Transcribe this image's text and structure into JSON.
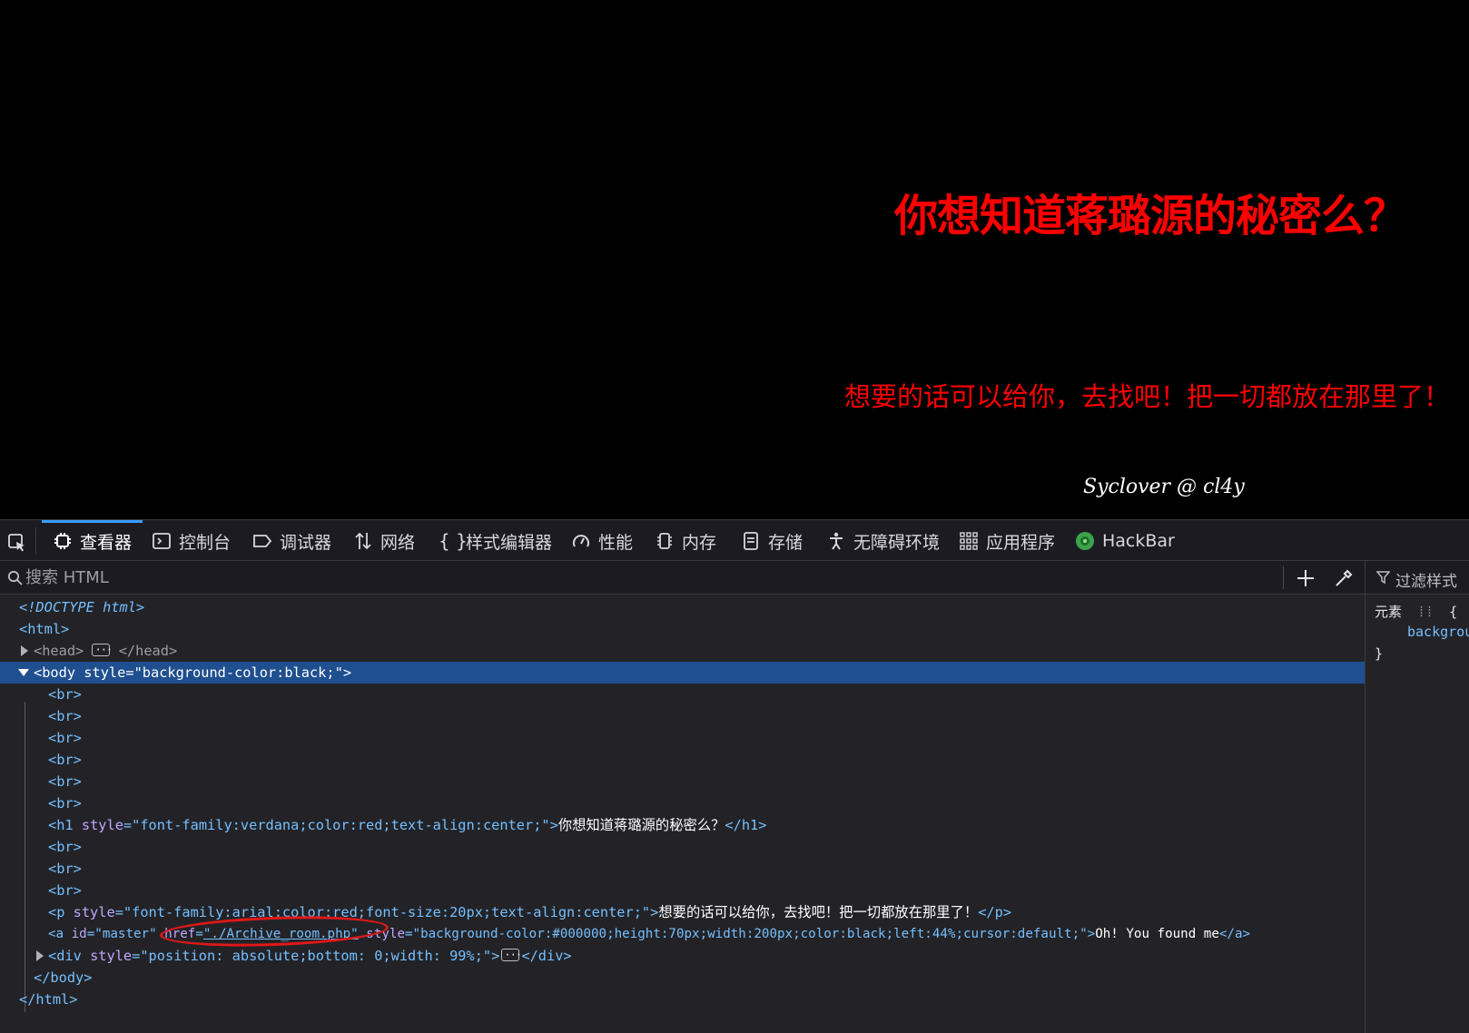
{
  "page": {
    "heading": "你想知道蒋璐源的秘密么？",
    "paragraph": "想要的话可以给你，去找吧！把一切都放在那里了！",
    "signature": "Syclover @ cl4y"
  },
  "devtools": {
    "tabs": [
      {
        "label": "查看器",
        "icon": "inspector-icon",
        "active": true
      },
      {
        "label": "控制台",
        "icon": "console-icon"
      },
      {
        "label": "调试器",
        "icon": "debugger-icon"
      },
      {
        "label": "网络",
        "icon": "network-icon"
      },
      {
        "label": "样式编辑器",
        "icon": "style-editor-icon"
      },
      {
        "label": "性能",
        "icon": "performance-icon"
      },
      {
        "label": "内存",
        "icon": "memory-icon"
      },
      {
        "label": "存储",
        "icon": "storage-icon"
      },
      {
        "label": "无障碍环境",
        "icon": "accessibility-icon"
      },
      {
        "label": "应用程序",
        "icon": "application-icon"
      },
      {
        "label": "HackBar",
        "icon": "hackbar-icon"
      }
    ],
    "search": {
      "placeholder": "搜索 HTML",
      "value": ""
    },
    "rules": {
      "filter_label": "过滤样式",
      "element_label": "元素",
      "open_brace": "{",
      "property": "backgrou",
      "close_brace": "}"
    },
    "markup": {
      "doctype": "<!DOCTYPE html>",
      "html_open": "<html>",
      "head_open": "<head>",
      "head_close": "</head>",
      "body_open": "<body",
      "body_style_attr": "style",
      "body_style_val": "\"background-color:black;\"",
      "br": "<br>",
      "h1_tag": "<h1",
      "h1_attr": "style",
      "h1_val": "\"font-family:verdana;color:red;text-align:center;\"",
      "h1_text": "你想知道蒋璐源的秘密么？",
      "h1_close": "</h1>",
      "p_tag": "<p",
      "p_attr": "style",
      "p_val": "\"font-family:arial;color:red;font-size:20px;text-align:center;\"",
      "p_text": "想要的话可以给你，去找吧！把一切都放在那里了！",
      "p_close": "</p>",
      "a_tag": "<a",
      "a_id_attr": "id",
      "a_id_val": "\"master\"",
      "a_href_attr": "href",
      "a_href_val": "\"./Archive_room.php\"",
      "a_style_attr": "style",
      "a_style_val": "\"background-color:#000000;height:70px;width:200px;color:black;left:44%;cursor:default;\"",
      "a_text": "Oh! You found me",
      "a_close": "</a>",
      "div_tag": "<div",
      "div_attr": "style",
      "div_val": "\"position: absolute;bottom: 0;width: 99%;\"",
      "div_close": "</div>",
      "body_close": "</body>",
      "html_close": "</html>",
      "gt": ">",
      "eq": "="
    }
  },
  "colors": {
    "accent": "#3b9cff",
    "selection": "#1f4f8f",
    "attr_name": "#c1a6ff",
    "attr_value": "#75bfff",
    "page_text": "#ff0000",
    "annotation": "#e01818"
  }
}
